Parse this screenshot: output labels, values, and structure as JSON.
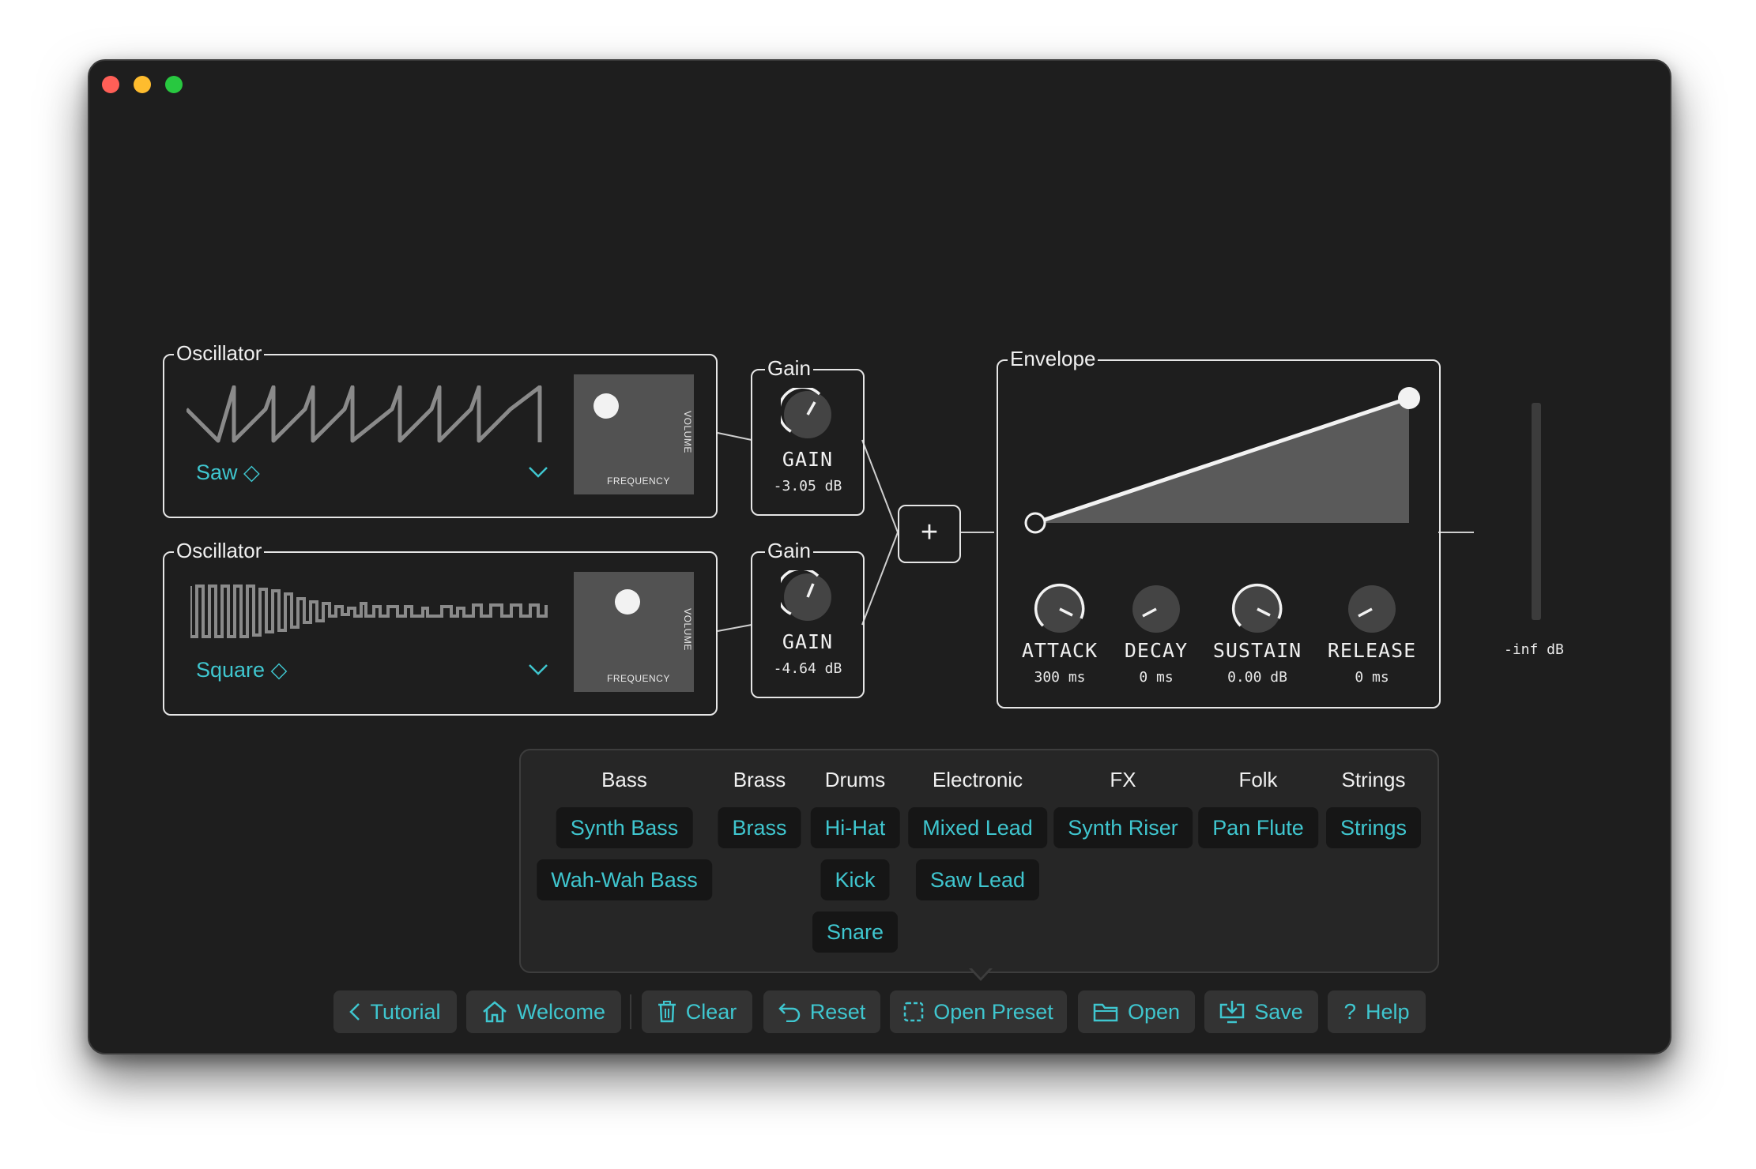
{
  "window": {
    "traffic_lights": [
      "close",
      "minimize",
      "zoom"
    ]
  },
  "oscillators": [
    {
      "title": "Oscillator",
      "waveform": "Saw ◇",
      "pad_y_label": "VOLUME",
      "pad_x_label": "FREQUENCY",
      "wave_icon": "saw-wave-icon"
    },
    {
      "title": "Oscillator",
      "waveform": "Square ◇",
      "pad_y_label": "VOLUME",
      "pad_x_label": "FREQUENCY",
      "wave_icon": "square-wave-icon"
    }
  ],
  "gains": [
    {
      "title": "Gain",
      "label": "GAIN",
      "value": "-3.05 dB"
    },
    {
      "title": "Gain",
      "label": "GAIN",
      "value": "-4.64 dB"
    }
  ],
  "mixer": {
    "symbol": "+"
  },
  "envelope": {
    "title": "Envelope",
    "knobs": [
      {
        "label": "ATTACK",
        "value": "300 ms"
      },
      {
        "label": "DECAY",
        "value": "0 ms"
      },
      {
        "label": "SUSTAIN",
        "value": "0.00 dB"
      },
      {
        "label": "RELEASE",
        "value": "0 ms"
      }
    ]
  },
  "meter": {
    "label": "-inf dB"
  },
  "presets": {
    "categories": [
      {
        "name": "Bass",
        "items": [
          "Synth Bass",
          "Wah-Wah Bass"
        ]
      },
      {
        "name": "Brass",
        "items": [
          "Brass"
        ]
      },
      {
        "name": "Drums",
        "items": [
          "Hi-Hat",
          "Kick",
          "Snare"
        ]
      },
      {
        "name": "Electronic",
        "items": [
          "Mixed Lead",
          "Saw Lead"
        ]
      },
      {
        "name": "FX",
        "items": [
          "Synth Riser"
        ]
      },
      {
        "name": "Folk",
        "items": [
          "Pan Flute"
        ]
      },
      {
        "name": "Strings",
        "items": [
          "Strings"
        ]
      }
    ]
  },
  "toolbar": {
    "tutorial": "Tutorial",
    "welcome": "Welcome",
    "clear": "Clear",
    "reset": "Reset",
    "open_preset": "Open Preset",
    "open": "Open",
    "save": "Save",
    "help": "Help"
  },
  "colors": {
    "accent": "#3fc6cf",
    "background": "#1e1e1e",
    "panel_border": "#e6e6e6"
  }
}
